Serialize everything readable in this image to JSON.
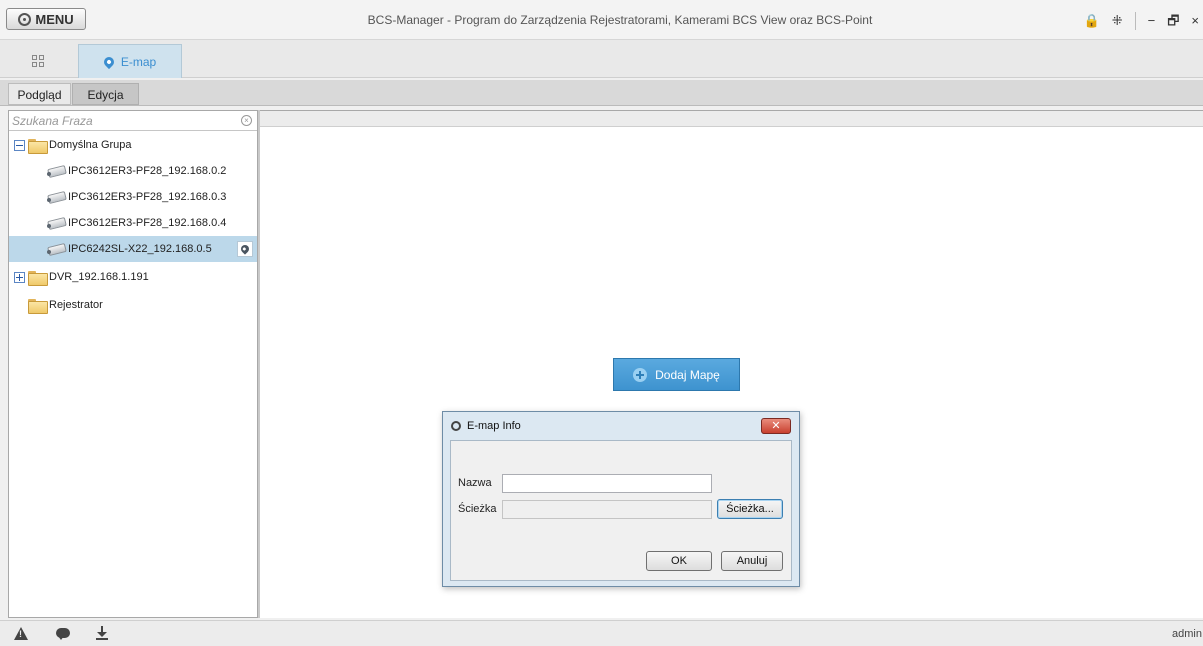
{
  "titlebar": {
    "menu_label": "MENU",
    "title": "BCS-Manager - Program do Zarządzenia Rejestratorami, Kamerami BCS View oraz BCS-Point",
    "controls": {
      "lock": "🔒",
      "layout": "⁜",
      "minimize": "−",
      "restore": "🗗",
      "close": "×"
    }
  },
  "tabs": {
    "emap_label": "E-map"
  },
  "mode_tabs": {
    "podglad": "Podgląd",
    "edycja": "Edycja"
  },
  "tree": {
    "search_placeholder": "Szukana Fraza",
    "groups": [
      {
        "label": "Domyślna Grupa",
        "expanded": true,
        "devices": [
          {
            "label": "IPC3612ER3-PF28_192.168.0.2"
          },
          {
            "label": "IPC3612ER3-PF28_192.168.0.3"
          },
          {
            "label": "IPC3612ER3-PF28_192.168.0.4"
          },
          {
            "label": "IPC6242SL-X22_192.168.0.5",
            "selected": true
          }
        ]
      },
      {
        "label": "DVR_192.168.1.191",
        "expanded": false
      },
      {
        "label": "Rejestrator"
      }
    ]
  },
  "map": {
    "add_map_label": "Dodaj Mapę"
  },
  "dialog": {
    "title": "E-map Info",
    "name_label": "Nazwa",
    "name_value": "",
    "path_label": "Ścieżka",
    "path_value": "",
    "browse_label": "Ścieżka...",
    "ok_label": "OK",
    "cancel_label": "Anuluj"
  },
  "status": {
    "user": "admin"
  },
  "colors": {
    "accent": "#3b8ed0",
    "selected_row": "#bcd8ea",
    "button_blue": "#4a9fd8",
    "close_red": "#c8402f"
  }
}
